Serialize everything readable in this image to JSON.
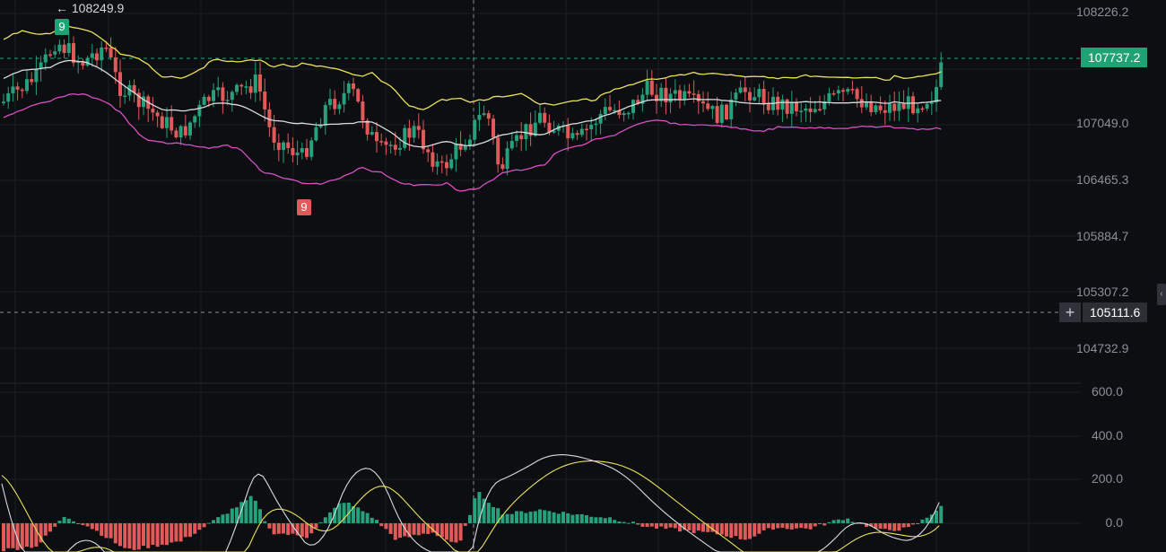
{
  "colors": {
    "background": "#0d0e11",
    "grid": "#1d1f24",
    "up": "#26a17b",
    "down": "#e05a5a",
    "boll_upper": "#e9e25a",
    "boll_mid": "#d9dbe0",
    "boll_lower": "#d94fc4",
    "price_tag": "#1fa374",
    "crosshair_tag": "#2b2e33"
  },
  "axis": {
    "price_ticks": [
      "108226.2",
      "107049.0",
      "106465.3",
      "105884.7",
      "105307.2",
      "104732.9"
    ],
    "macd_ticks": [
      "600.0",
      "400.0",
      "200.0",
      "0.0"
    ]
  },
  "last_price": "107737.2",
  "crosshair_price": "105111.6",
  "crosshair_icon": "plus-icon",
  "high_label": "← 108249.9",
  "markers": {
    "top": "9",
    "bottom": "9"
  },
  "chart_data": [
    {
      "type": "candlestick",
      "title": "",
      "y_range": [
        104500,
        108400
      ],
      "bollinger_bands": {
        "upper": "yellow",
        "middle": "white",
        "lower": "magenta"
      },
      "last_price": 107737.2,
      "high_marker": 108249.9
    },
    {
      "type": "bar",
      "title": "",
      "indicator": "MACD",
      "y_range": [
        -100,
        650
      ],
      "series": [
        {
          "values": "histogram"
        },
        {
          "values": "line-white"
        },
        {
          "values": "line-yellow"
        }
      ]
    }
  ]
}
